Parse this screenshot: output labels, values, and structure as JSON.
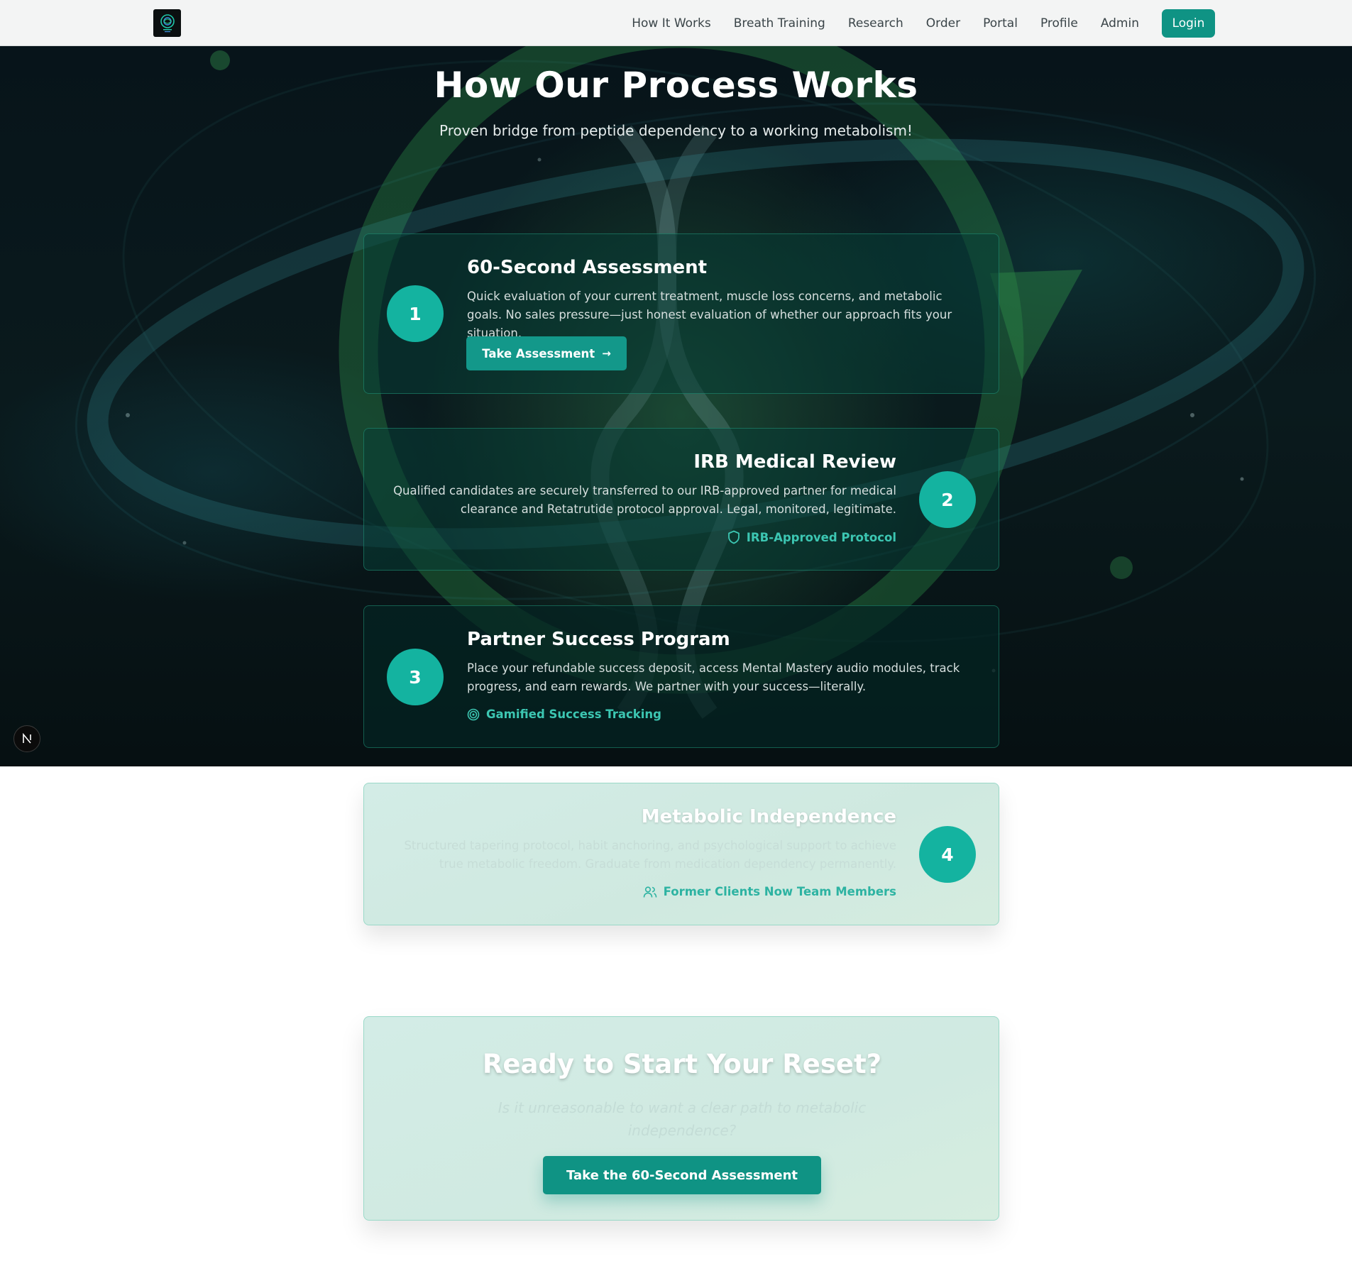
{
  "nav": {
    "logo_icon": "brain-logo-icon",
    "links": [
      "How It Works",
      "Breath Training",
      "Research",
      "Order",
      "Portal",
      "Profile",
      "Admin"
    ],
    "login_label": "Login"
  },
  "hero": {
    "title": "How Our Process Works",
    "subtitle": "Proven bridge from peptide dependency to a working metabolism!"
  },
  "steps": [
    {
      "number": "1",
      "title": "60-Second Assessment",
      "text": "Quick evaluation of your current treatment, muscle loss concerns, and metabolic goals. No sales pressure—just honest evaluation of whether our approach fits your situation.",
      "button_label": "Take Assessment",
      "button_icon": "arrow-right-icon"
    },
    {
      "number": "2",
      "title": "IRB Medical Review",
      "text": "Qualified candidates are securely transferred to our IRB-approved partner for medical clearance and Retatrutide protocol approval. Legal, monitored, legitimate.",
      "tag": "IRB-Approved Protocol",
      "tag_icon": "shield-icon"
    },
    {
      "number": "3",
      "title": "Partner Success Program",
      "text": "Place your refundable success deposit, access Mental Mastery audio modules, track progress, and earn rewards. We partner with your success—literally.",
      "tag": "Gamified Success Tracking",
      "tag_icon": "target-icon"
    },
    {
      "number": "4",
      "title": "Metabolic Independence",
      "text": "Structured tapering protocol, habit anchoring, and psychological support to achieve true metabolic freedom. Graduate from medication dependency permanently.",
      "tag": "Former Clients Now Team Members",
      "tag_icon": "users-icon"
    }
  ],
  "cta": {
    "title": "Ready to Start Your Reset?",
    "subtitle": "Is it unreasonable to want a clear path to metabolic independence?",
    "button_label": "Take the 60-Second Assessment"
  },
  "badge": {
    "label": "N"
  },
  "colors": {
    "accent": "#0f9384",
    "circle": "#14b3a0",
    "tag": "#3cc6b2"
  }
}
